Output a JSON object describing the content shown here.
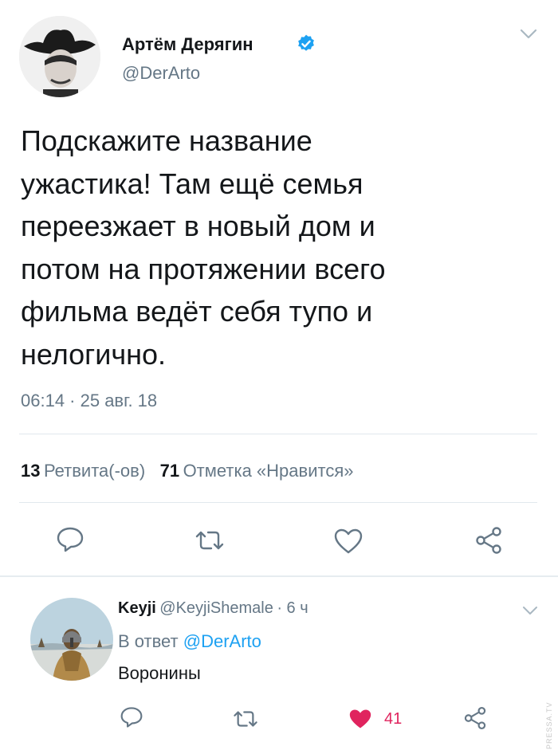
{
  "tweet": {
    "author_name": "Артём Дерягин",
    "author_handle": "@DerArto",
    "text_lines": [
      "Подскажите название",
      "ужастика! Там ещё семья",
      "переезжает в новый дом и",
      "потом на протяжении всего",
      "фильма ведёт себя тупо и",
      "нелогично."
    ],
    "timestamp": "06:14 · 25 авг. 18",
    "retweets_count": "13",
    "retweets_label": "Ретвита(-ов)",
    "likes_count": "71",
    "likes_label": "Отметка «Нравится»"
  },
  "reply": {
    "author_name": "Keyji",
    "author_handle": "@KeyjiShemale",
    "time": "· 6 ч",
    "in_reply_to_prefix": "В ответ",
    "in_reply_to_handle": "@DerArto",
    "text": "Воронины",
    "likes_count": "41"
  },
  "watermark": "PRESSA.TV",
  "icons": {
    "verified": "verified-badge-icon",
    "menu": "chevron-down-icon",
    "reply": "reply-bubble-icon",
    "retweet": "retweet-icon",
    "like": "heart-icon",
    "share": "share-icon"
  },
  "colors": {
    "verified": "#1da1f2",
    "link": "#1da1f2",
    "liked": "#e0245e",
    "muted": "#657786"
  }
}
